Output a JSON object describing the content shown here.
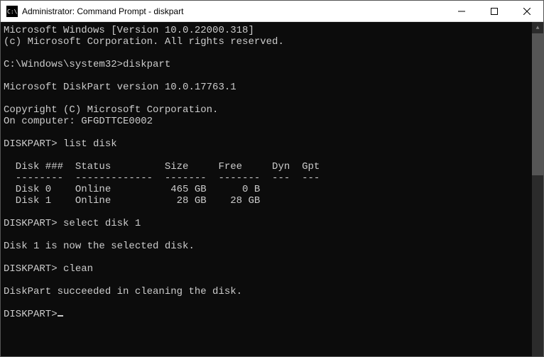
{
  "titlebar": {
    "title": "Administrator: Command Prompt - diskpart"
  },
  "terminal": {
    "lines": [
      "Microsoft Windows [Version 10.0.22000.318]",
      "(c) Microsoft Corporation. All rights reserved.",
      "",
      "C:\\Windows\\system32>diskpart",
      "",
      "Microsoft DiskPart version 10.0.17763.1",
      "",
      "Copyright (C) Microsoft Corporation.",
      "On computer: GFGDTTCE0002",
      "",
      "DISKPART> list disk",
      "",
      "  Disk ###  Status         Size     Free     Dyn  Gpt",
      "  --------  -------------  -------  -------  ---  ---",
      "  Disk 0    Online          465 GB      0 B",
      "  Disk 1    Online           28 GB    28 GB",
      "",
      "DISKPART> select disk 1",
      "",
      "Disk 1 is now the selected disk.",
      "",
      "DISKPART> clean",
      "",
      "DiskPart succeeded in cleaning the disk.",
      "",
      "DISKPART>"
    ]
  }
}
